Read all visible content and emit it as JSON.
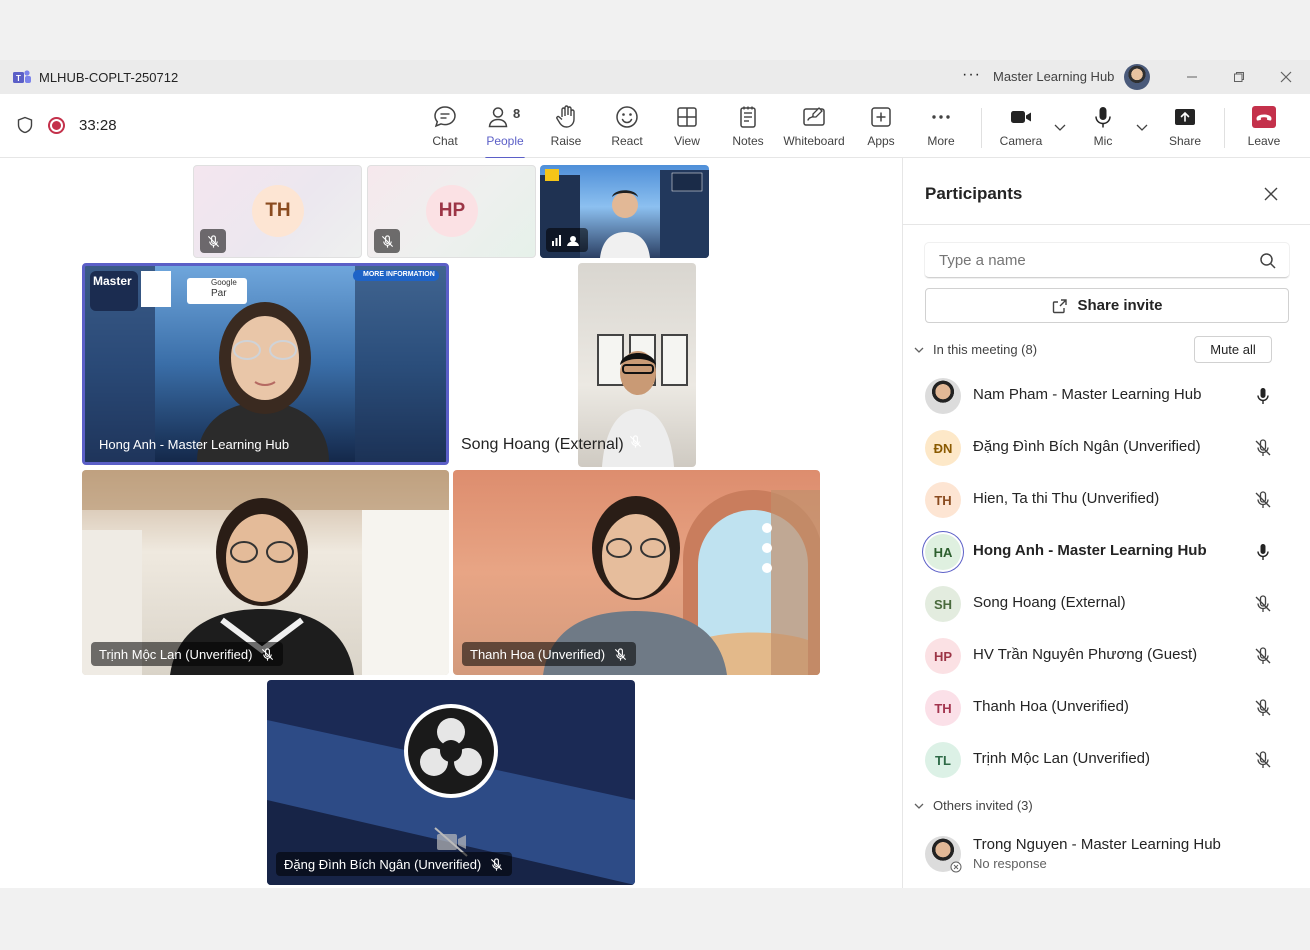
{
  "window": {
    "title": "MLHUB-COPLT-250712",
    "org_name": "Master Learning Hub"
  },
  "toolbar": {
    "timer": "33:28",
    "people_count": "8",
    "buttons": {
      "chat": "Chat",
      "people": "People",
      "raise": "Raise",
      "react": "React",
      "view": "View",
      "notes": "Notes",
      "whiteboard": "Whiteboard",
      "apps": "Apps",
      "more": "More",
      "camera": "Camera",
      "mic": "Mic",
      "share": "Share",
      "leave": "Leave"
    }
  },
  "stage": {
    "tiles": {
      "th_initials": "TH",
      "hp_initials": "HP",
      "hong_anh": "Hong Anh - Master Learning Hub",
      "song_hoang": "Song Hoang (External)",
      "trinh_moc_lan": "Trịnh Mộc Lan (Unverified)",
      "thanh_hoa": "Thanh Hoa (Unverified)",
      "dang_dinh": "Đặng Đình Bích Ngân (Unverified)"
    },
    "banner": {
      "more_info": "MORE INFORMATION",
      "master": "Master",
      "google": "Google",
      "google_partner": "Par"
    }
  },
  "panel": {
    "title": "Participants",
    "search_placeholder": "Type a name",
    "share_invite": "Share invite",
    "in_meeting_label": "In this meeting (8)",
    "mute_all": "Mute all",
    "others_label": "Others invited (3)",
    "participants": [
      {
        "initials": "",
        "name": "Nam Pham - Master Learning Hub",
        "mic": "on",
        "bg": "photo"
      },
      {
        "initials": "ĐN",
        "name": "Đặng Đình Bích Ngân (Unverified)",
        "mic": "off",
        "bg": "#fde8c8",
        "fg": "#8a5a00"
      },
      {
        "initials": "TH",
        "name": "Hien, Ta thi Thu (Unverified)",
        "mic": "off",
        "bg": "#fde5d3",
        "fg": "#8a4b1f"
      },
      {
        "initials": "HA",
        "name": "Hong Anh - Master Learning Hub",
        "mic": "on",
        "bg": "#dff0e0",
        "fg": "#2d5f2e"
      },
      {
        "initials": "SH",
        "name": "Song Hoang (External)",
        "mic": "off",
        "bg": "#e3ecdf",
        "fg": "#4a6a3d"
      },
      {
        "initials": "HP",
        "name": "HV Trần Nguyên Phương (Guest)",
        "mic": "off",
        "bg": "#fbe1e4",
        "fg": "#9c3546"
      },
      {
        "initials": "TH",
        "name": "Thanh Hoa (Unverified)",
        "mic": "off",
        "bg": "#fbe0e8",
        "fg": "#a3344e"
      },
      {
        "initials": "TL",
        "name": "Trịnh Mộc Lan (Unverified)",
        "mic": "off",
        "bg": "#dcf1e6",
        "fg": "#2e6a47"
      }
    ],
    "others": [
      {
        "name": "Trong Nguyen - Master Learning Hub",
        "status": "No response"
      }
    ]
  }
}
